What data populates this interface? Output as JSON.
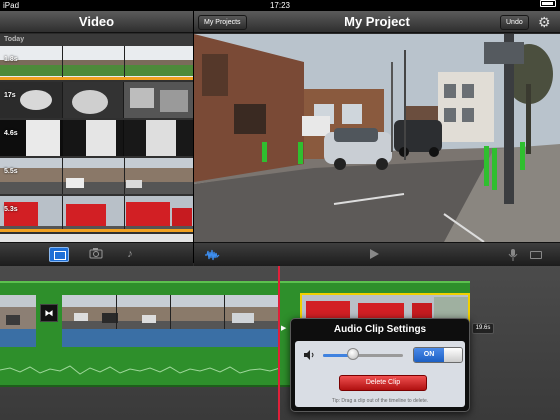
{
  "status": {
    "carrier": "iPad",
    "time": "17:23"
  },
  "media_browser": {
    "title": "Video",
    "section_label": "Today",
    "clips": [
      {
        "duration": "1.8s"
      },
      {
        "duration": "17s"
      },
      {
        "duration": "4.6s"
      },
      {
        "duration": "5.5s"
      },
      {
        "duration": "5.3s"
      }
    ]
  },
  "header": {
    "my_projects_label": "My Projects",
    "project_title": "My Project",
    "undo_label": "Undo"
  },
  "timeline": {
    "selected_clip_duration": "19.6s"
  },
  "popover": {
    "title": "Audio Clip Settings",
    "volume_level": 0.38,
    "toggle_label": "ON",
    "delete_label": "Delete Clip",
    "tip": "Tip: Drag a clip out of the timeline to delete."
  },
  "colors": {
    "playhead": "#e0203a",
    "selection": "#f0d000",
    "track_green": "#2e8f2b",
    "accent_blue": "#1e6fd6"
  }
}
